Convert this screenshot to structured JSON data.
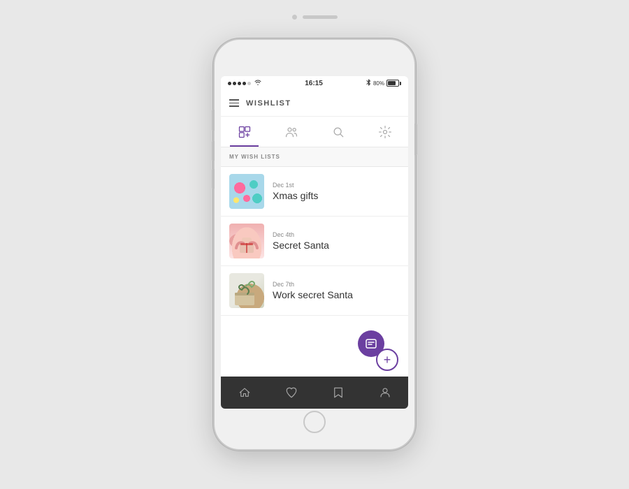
{
  "phone": {
    "status_bar": {
      "signal": "•••••",
      "wifi": "wifi",
      "time": "16:15",
      "bluetooth": "* 80%"
    },
    "app_header": {
      "title": "WISHLIST"
    },
    "nav_tabs": [
      {
        "id": "wishlist",
        "label": "wishlist-icon",
        "active": true
      },
      {
        "id": "people",
        "label": "people-icon",
        "active": false
      },
      {
        "id": "search",
        "label": "search-icon",
        "active": false
      },
      {
        "id": "settings",
        "label": "settings-icon",
        "active": false
      }
    ],
    "section_header": "MY WISH LISTS",
    "wish_lists": [
      {
        "id": "xmas",
        "date": "Dec 1st",
        "name": "Xmas gifts",
        "thumb": "xmas"
      },
      {
        "id": "secret-santa",
        "date": "Dec 4th",
        "name": "Secret Santa",
        "thumb": "santa"
      },
      {
        "id": "work-secret-santa",
        "date": "Dec 7th",
        "name": "Work secret Santa",
        "thumb": "work"
      }
    ],
    "bottom_nav": [
      "home",
      "heart",
      "bookmark",
      "user"
    ],
    "fab_label": "+"
  },
  "colors": {
    "accent": "#6b3fa0",
    "dark_nav": "#333333",
    "light_bg": "#f8f8f8"
  }
}
